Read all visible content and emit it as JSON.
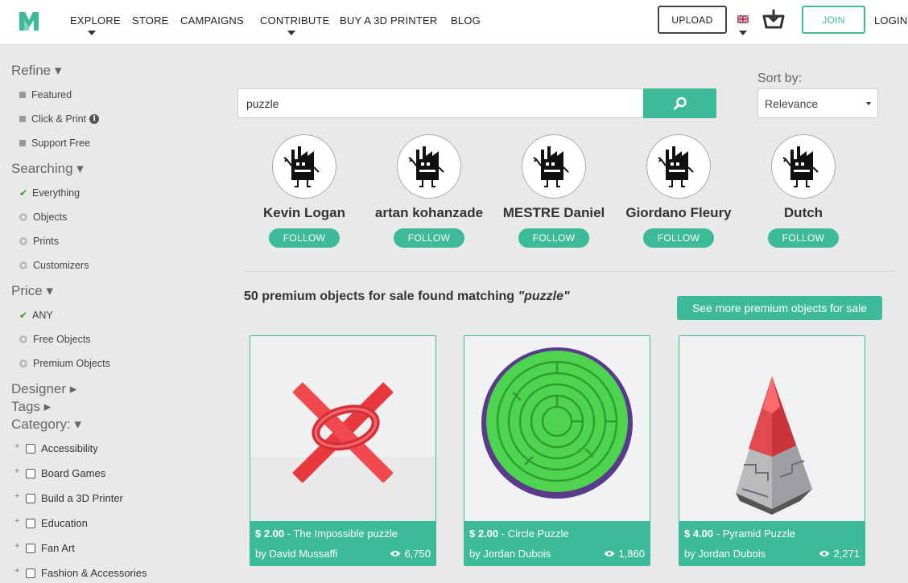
{
  "header": {
    "nav": [
      "EXPLORE",
      "STORE",
      "CAMPAIGNS",
      "CONTRIBUTE",
      "BUY A 3D PRINTER",
      "BLOG"
    ],
    "upload_label": "UPLOAD",
    "join_label": "JOIN",
    "login_label": "LOGIN"
  },
  "sidebar": {
    "refine": {
      "title": "Refine ▾",
      "options": [
        "Featured",
        "Click & Print",
        "Support Free"
      ]
    },
    "searching": {
      "title": "Searching ▾",
      "options": [
        "Everything",
        "Objects",
        "Prints",
        "Customizers"
      ],
      "selected": "Everything"
    },
    "price": {
      "title": "Price ▾",
      "options": [
        "ANY",
        "Free Objects",
        "Premium Objects"
      ],
      "selected": "ANY"
    },
    "designer_title": "Designer ▸",
    "tags_title": "Tags ▸",
    "category": {
      "title": "Category: ▾",
      "items": [
        "Accessibility",
        "Board Games",
        "Build a 3D Printer",
        "Education",
        "Fan Art",
        "Fashion & Accessories"
      ]
    }
  },
  "search": {
    "value": "puzzle",
    "sort_label": "Sort by:",
    "sort_value": "Relevance"
  },
  "designers": [
    {
      "name": "Kevin Logan",
      "follow": "FOLLOW"
    },
    {
      "name": "artan kohanzade",
      "follow": "FOLLOW"
    },
    {
      "name": "MESTRE Daniel",
      "follow": "FOLLOW"
    },
    {
      "name": "Giordano Fleury",
      "follow": "FOLLOW"
    },
    {
      "name": "Dutch",
      "follow": "FOLLOW"
    }
  ],
  "results": {
    "prefix": "50 premium objects for sale found matching ",
    "query": "\"puzzle\"",
    "see_more": "See more premium objects for sale"
  },
  "products": [
    {
      "price": "$ 2.00",
      "title": " - The Impossible puzzle",
      "author": "by David Mussaffi",
      "views": "6,750"
    },
    {
      "price": "$ 2.00",
      "title": " - Circle Puzzle",
      "author": "by Jordan Dubois",
      "views": "1,860"
    },
    {
      "price": "$ 4.00",
      "title": " - Pyramid Puzzle",
      "author": "by Jordan Dubois",
      "views": "2,271"
    }
  ],
  "colors": {
    "accent": "#3dbb98",
    "background": "#e9e9e9"
  },
  "icons": {
    "logo": "myminifactory-logo-icon",
    "search": "search-icon",
    "cart": "cart-icon",
    "flag": "uk-flag-icon",
    "info": "info-icon",
    "views": "eye-icon"
  }
}
